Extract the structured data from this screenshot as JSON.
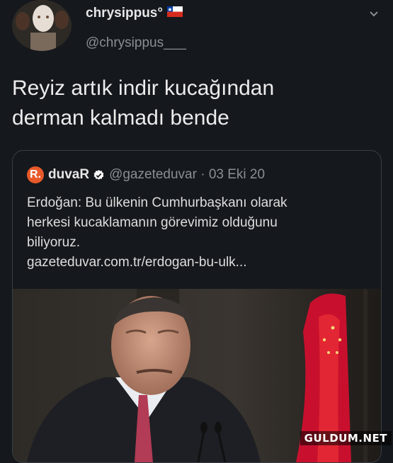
{
  "tweet": {
    "display_name": "chrysippus°",
    "handle": "@chrysippus___",
    "text_line1": "Reyiz artık indir kucağından",
    "text_line2": "derman kalmadı bende"
  },
  "quote": {
    "logo_letter": "R.",
    "name": "duvaR",
    "handle_date": "@gazeteduvar · 03 Eki 20",
    "text_line1": "Erdoğan: Bu ülkenin Cumhurbaşkanı olarak",
    "text_line2": "herkesi kucaklamanın görevimiz olduğunu",
    "text_line3": "biliyoruz.",
    "link": "gazeteduvar.com.tr/erdogan-bu-ulk..."
  },
  "watermark": "GULDUM.NET",
  "icons": {
    "flag": "chile-flag-icon",
    "menu": "chevron-down-icon",
    "verified": "verified-badge-icon"
  },
  "colors": {
    "background": "#15181c",
    "brand_orange": "#e85a2a",
    "verified_blue": "#ffffff"
  }
}
